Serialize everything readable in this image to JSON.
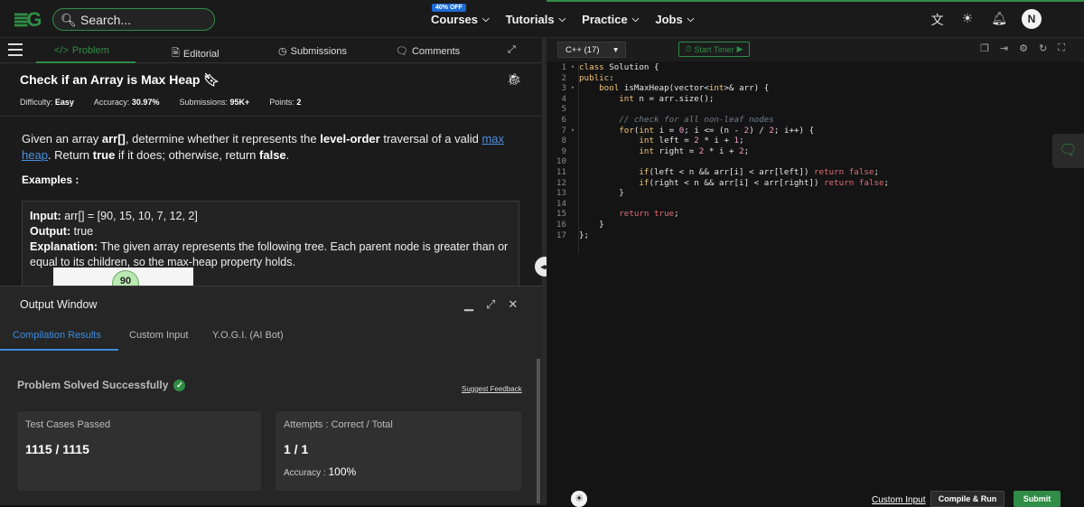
{
  "header": {
    "search_placeholder": "Search...",
    "offer_badge": "40% OFF",
    "nav": [
      "Courses",
      "Tutorials",
      "Practice",
      "Jobs"
    ],
    "avatar_initial": "N"
  },
  "problem_tabs": [
    "Problem",
    "Editorial",
    "Submissions",
    "Comments"
  ],
  "problem": {
    "title": "Check if an Array is Max Heap",
    "difficulty_label": "Difficulty:",
    "difficulty": "Easy",
    "accuracy_label": "Accuracy:",
    "accuracy": "30.97%",
    "submissions_label": "Submissions:",
    "submissions": "95K+",
    "points_label": "Points:",
    "points": "2",
    "desc_1": "Given an array ",
    "desc_arr": "arr[]",
    "desc_2": ", determine whether it represents the ",
    "desc_level": "level-order",
    "desc_3": " traversal of a valid ",
    "desc_link": "max heap",
    "desc_4": ". Return ",
    "desc_true": "true",
    "desc_5": " if it does; otherwise, return ",
    "desc_false": "false",
    "desc_6": ".",
    "examples_label": "Examples :",
    "example": {
      "input_label": "Input:",
      "input": " arr[] = [90, 15, 10, 7, 12, 2]",
      "output_label": "Output:",
      "output": " true",
      "explanation_label": "Explanation:",
      "explanation": " The given array represents the following tree. Each parent node is greater than or equal to its children, so the max-heap property holds.",
      "tree_root": "90"
    }
  },
  "output_window": {
    "title": "Output Window",
    "tabs": [
      "Compilation Results",
      "Custom Input",
      "Y.O.G.I. (AI Bot)"
    ],
    "status": "Problem Solved Successfully",
    "feedback": "Suggest Feedback",
    "tests_label": "Test Cases Passed",
    "tests_value": "1115 / 1115",
    "attempts_label": "Attempts : Correct / Total",
    "attempts_value": "1 / 1",
    "accuracy_label": "Accuracy : ",
    "accuracy_value": "100%"
  },
  "editor": {
    "language": "C++ (17)",
    "timer_label": "Start Timer",
    "custom_input": "Custom Input",
    "compile_run": "Compile & Run",
    "submit": "Submit"
  },
  "colors": {
    "brand": "#2f8d46",
    "link": "#4a90e2",
    "tab_active": "#3a8dde"
  }
}
